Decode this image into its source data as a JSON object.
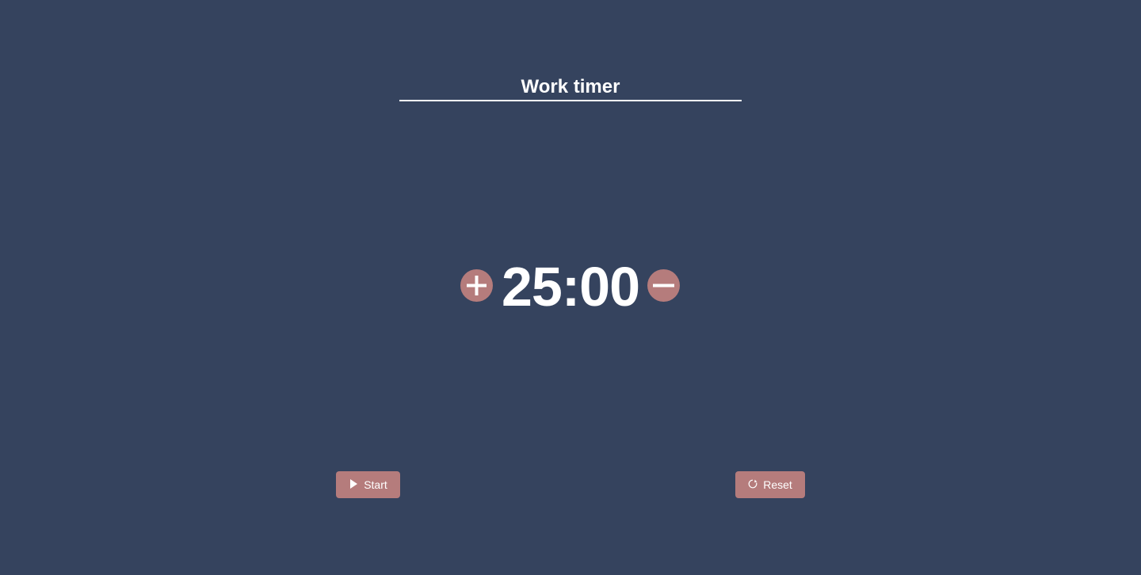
{
  "title": "Work timer",
  "timer": {
    "display": "25:00",
    "increment_icon": "plus-icon",
    "decrement_icon": "minus-icon"
  },
  "controls": {
    "start_label": "Start",
    "start_icon": "play-icon",
    "reset_label": "Reset",
    "reset_icon": "refresh-icon"
  },
  "colors": {
    "background": "#35435e",
    "accent": "#b57c7c",
    "text": "#ffffff"
  }
}
